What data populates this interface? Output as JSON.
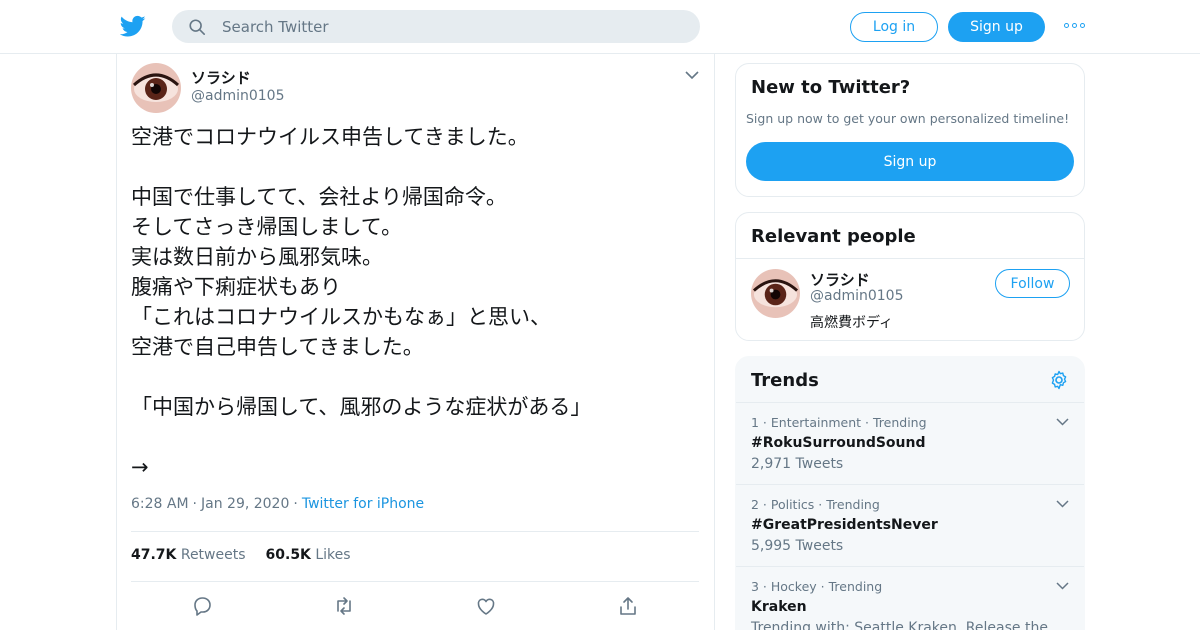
{
  "header": {
    "search_placeholder": "Search Twitter",
    "login_label": "Log in",
    "signup_label": "Sign up"
  },
  "colors": {
    "accent": "#1da1f2",
    "link": "#1b95e0",
    "muted": "#657786",
    "border": "#e6ecf0"
  },
  "icons": [
    "twitter-bird-icon",
    "search-icon",
    "more-dots-icon",
    "chevron-down-icon",
    "reply-icon",
    "retweet-icon",
    "like-icon",
    "share-icon",
    "gear-icon"
  ],
  "tweet": {
    "author_name": "ソラシド",
    "author_handle": "@admin0105",
    "lines": [
      "空港でコロナウイルス申告してきました。",
      "",
      "中国で仕事してて、会社より帰国命令。",
      "そしてさっき帰国しまして。",
      "実は数日前から風邪気味。",
      "腹痛や下痢症状もあり",
      "「これはコロナウイルスかもなぁ」と思い、",
      "空港で自己申告してきました。",
      "",
      "「中国から帰国して、風邪のような症状がある」",
      "",
      "→"
    ],
    "time": "6:28 AM",
    "date": "Jan 29, 2020",
    "source": "Twitter for iPhone",
    "retweets_count": "47.7K",
    "retweets_label": "Retweets",
    "likes_count": "60.5K",
    "likes_label": "Likes"
  },
  "sidebar": {
    "new_to_twitter": {
      "title": "New to Twitter?",
      "subtitle": "Sign up now to get your own personalized timeline!",
      "button_label": "Sign up"
    },
    "relevant_people": {
      "title": "Relevant people",
      "name": "ソラシド",
      "handle": "@admin0105",
      "bio": "高燃費ボディ",
      "follow_label": "Follow"
    },
    "trends": {
      "title": "Trends",
      "items": [
        {
          "rank": "1",
          "category": "Entertainment",
          "status": "Trending",
          "name": "#RokuSurroundSound",
          "count": "2,971 Tweets"
        },
        {
          "rank": "2",
          "category": "Politics",
          "status": "Trending",
          "name": "#GreatPresidentsNever",
          "count": "5,995 Tweets"
        },
        {
          "rank": "3",
          "category": "Hockey",
          "status": "Trending",
          "name": "Kraken",
          "count": "Trending with: Seattle Kraken, Release the"
        }
      ]
    }
  }
}
